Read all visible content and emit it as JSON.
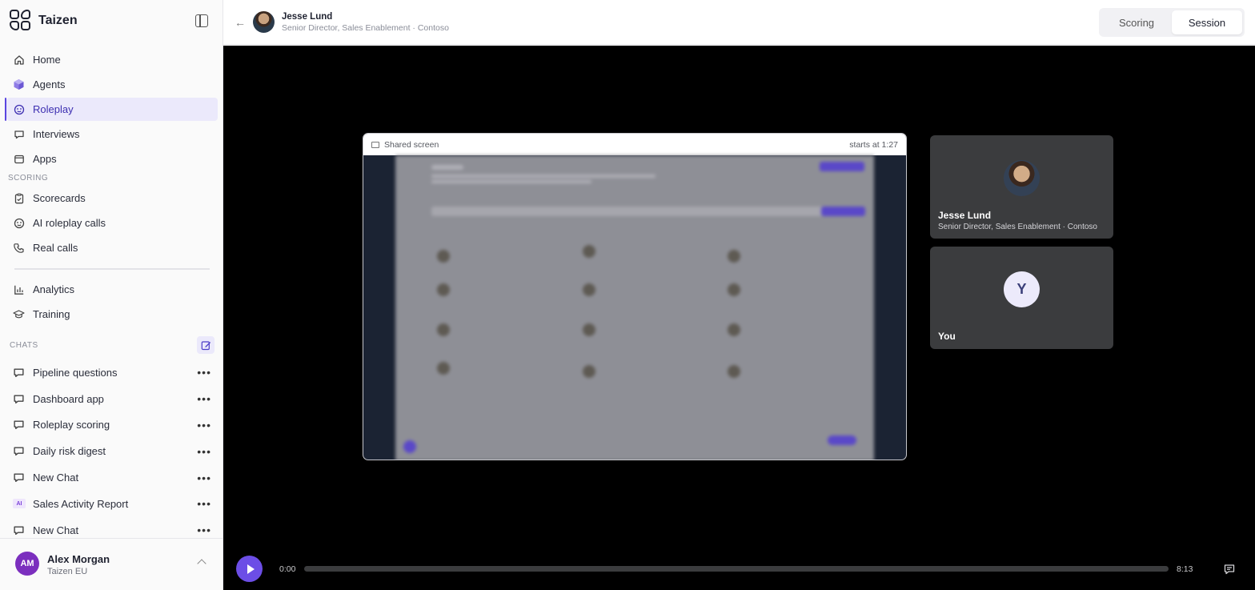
{
  "brand": {
    "name": "Taizen"
  },
  "nav": {
    "main": [
      {
        "label": "Home",
        "icon": "home-icon"
      },
      {
        "label": "Agents",
        "icon": "cube-icon"
      },
      {
        "label": "Roleplay",
        "icon": "roleplay-icon",
        "active": true
      },
      {
        "label": "Interviews",
        "icon": "chat-bubble-icon"
      },
      {
        "label": "Apps",
        "icon": "apps-icon"
      }
    ],
    "scoring_label": "SCORING",
    "scoring": [
      {
        "label": "Scorecards",
        "icon": "clipboard-icon"
      },
      {
        "label": "AI roleplay calls",
        "icon": "roleplay-icon"
      },
      {
        "label": "Real calls",
        "icon": "phone-icon"
      }
    ],
    "other": [
      {
        "label": "Analytics",
        "icon": "bar-chart-icon"
      },
      {
        "label": "Training",
        "icon": "graduation-cap-icon"
      }
    ]
  },
  "chats": {
    "label": "CHATS",
    "items": [
      {
        "label": "Pipeline questions"
      },
      {
        "label": "Dashboard app"
      },
      {
        "label": "Roleplay scoring"
      },
      {
        "label": "Daily risk digest"
      },
      {
        "label": "New Chat"
      },
      {
        "label": "Sales Activity Report",
        "badge": "AI"
      },
      {
        "label": "New Chat"
      }
    ],
    "more_label": "•••"
  },
  "user": {
    "initials": "AM",
    "name": "Alex Morgan",
    "org": "Taizen EU"
  },
  "header": {
    "back": "←",
    "name": "Jesse Lund",
    "title": "Senior Director, Sales Enablement · Contoso",
    "tabs": [
      {
        "label": "Scoring"
      },
      {
        "label": "Session",
        "active": true
      }
    ]
  },
  "session": {
    "share_label": "Shared screen",
    "starts_at": "starts at 1:27",
    "participants": [
      {
        "name": "Jesse Lund",
        "subtitle": "Senior Director, Sales Enablement · Contoso"
      },
      {
        "initial": "Y",
        "name": "You"
      }
    ]
  },
  "player": {
    "current": "0:00",
    "duration": "8:13",
    "progress": 0
  },
  "colors": {
    "accent": "#6c4ee6",
    "active_nav_bg": "#ebe9fb",
    "stage_bg": "#000000"
  }
}
